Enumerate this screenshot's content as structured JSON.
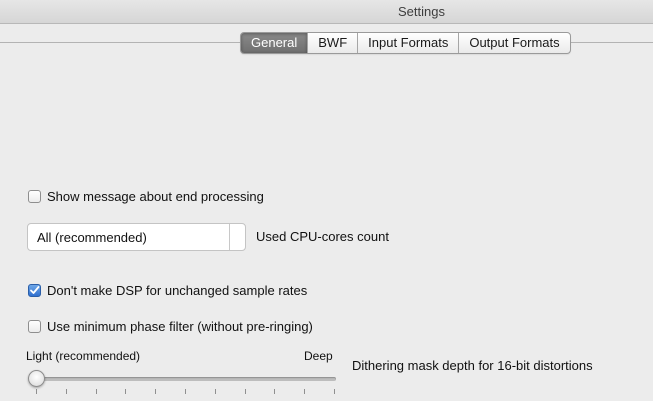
{
  "window": {
    "title": "Settings"
  },
  "tabs": [
    {
      "label": "General",
      "active": true
    },
    {
      "label": "BWF",
      "active": false
    },
    {
      "label": "Input Formats",
      "active": false
    },
    {
      "label": "Output Formats",
      "active": false
    }
  ],
  "general": {
    "show_message": {
      "label": "Show message about end processing",
      "checked": false
    },
    "cpu_cores": {
      "value": "All (recommended)",
      "label": "Used CPU-cores count"
    },
    "no_dsp": {
      "label": "Don't make DSP for unchanged sample rates",
      "checked": true
    },
    "min_phase": {
      "label": "Use minimum phase filter (without pre-ringing)",
      "checked": false
    },
    "dither": {
      "min_label": "Light (recommended)",
      "max_label": "Deep",
      "label": "Dithering mask depth for 16-bit distortions",
      "level": 0,
      "tick_count": 11
    }
  },
  "colors": {
    "accent": "#2f6fcf",
    "window_bg": "#ececec"
  }
}
